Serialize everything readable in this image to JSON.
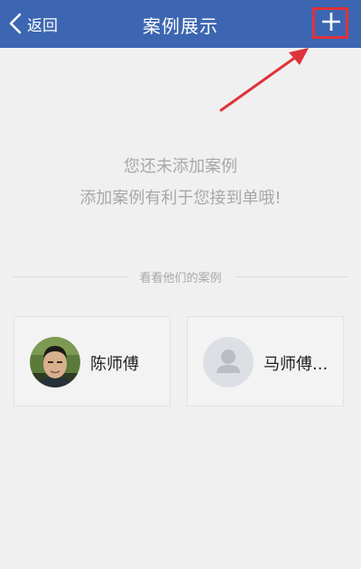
{
  "header": {
    "back_label": "返回",
    "title": "案例展示",
    "add_icon": "plus-icon"
  },
  "empty_state": {
    "line1": "您还未添加案例",
    "line2": "添加案例有利于您接到单哦!"
  },
  "others_section": {
    "divider_label": "看看他们的案例",
    "masters": [
      {
        "name": "陈师傅",
        "avatar": "photo"
      },
      {
        "name": "马师傅...",
        "avatar": "default-person-icon"
      }
    ]
  },
  "colors": {
    "header_bg": "#3c66b1",
    "page_bg": "#f0f0f0",
    "annotation_red": "#e0323a",
    "muted_text": "#a8a8a8"
  }
}
